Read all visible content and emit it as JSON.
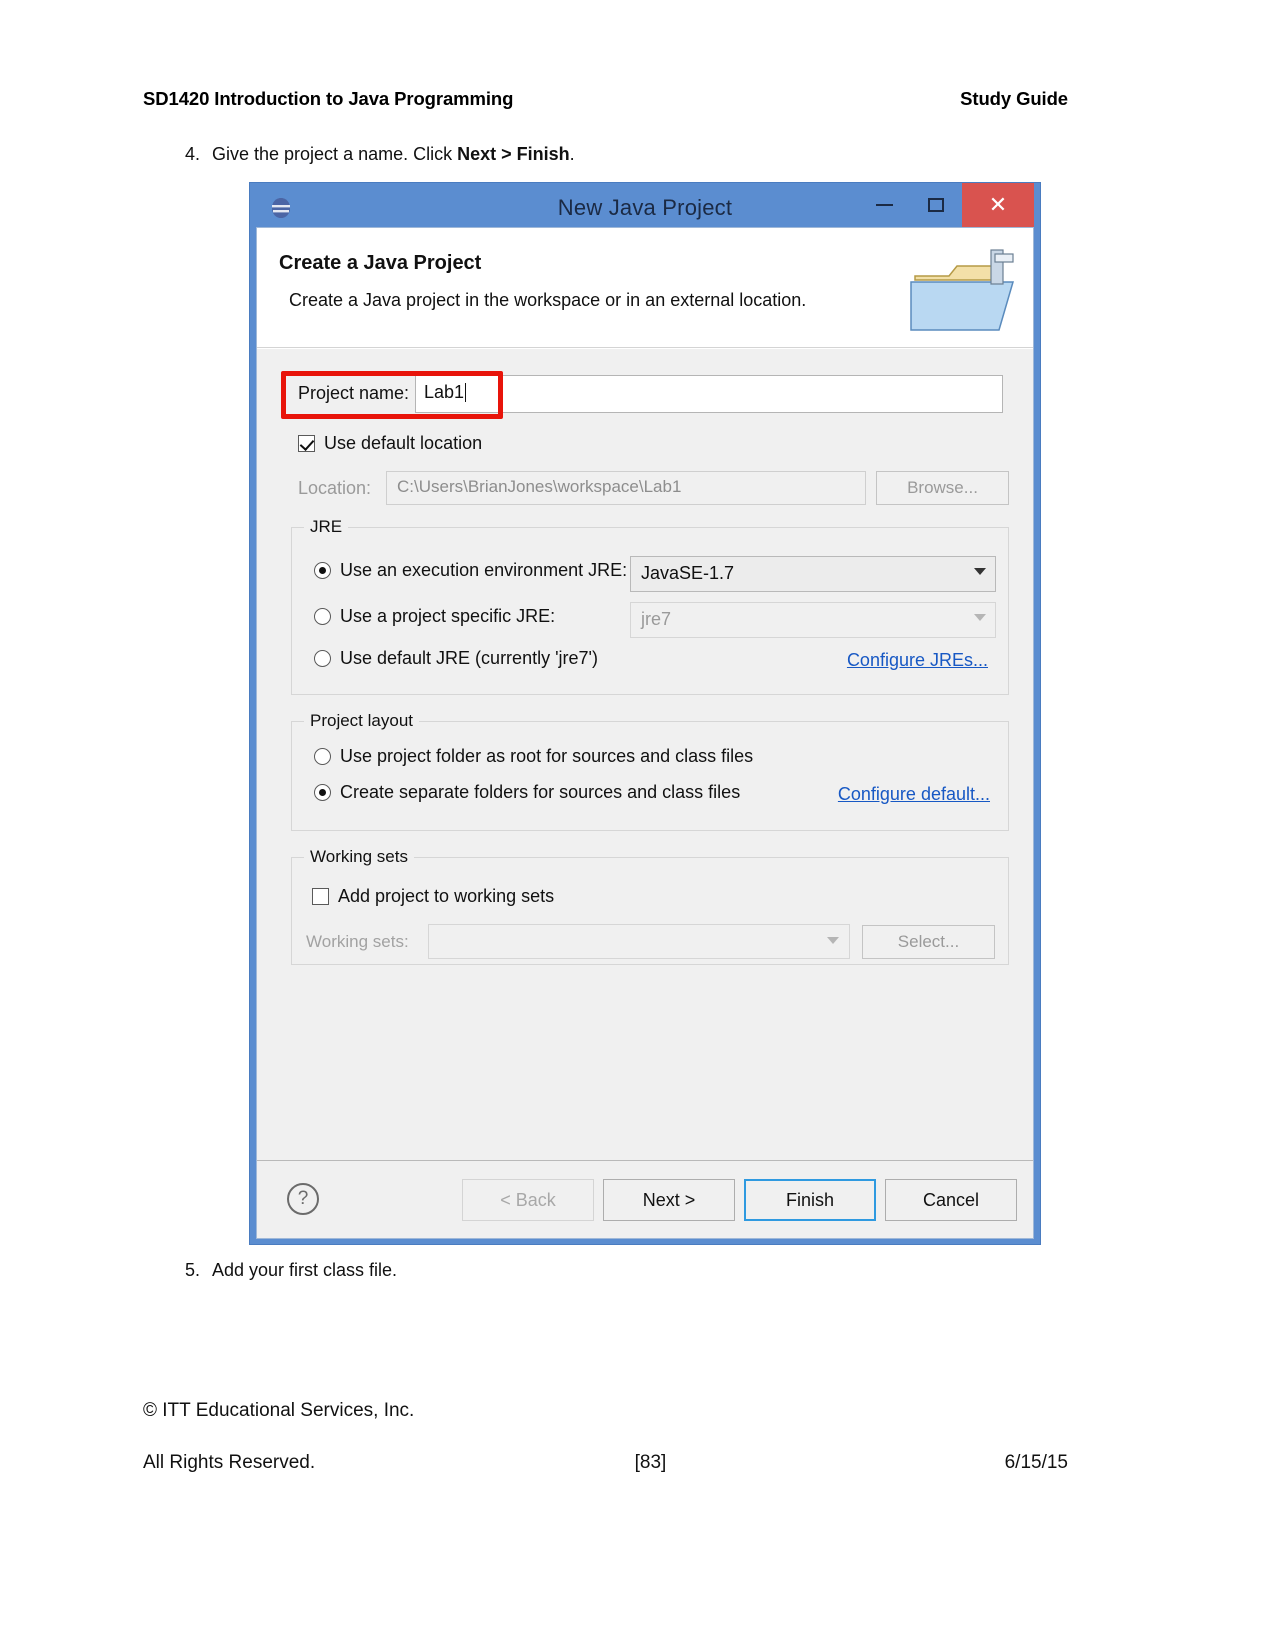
{
  "document": {
    "header_left": "SD1420 Introduction to Java Programming",
    "header_right": "Study Guide",
    "step4": {
      "number": "4.",
      "text_before": "Give the project a name. Click ",
      "bold1": "Next",
      "between": " > ",
      "bold2": "Finish",
      "text_after": "."
    },
    "step5": {
      "number": "5.",
      "text": "Add your first class file."
    },
    "footer": {
      "copyright": "© ITT Educational Services, Inc.",
      "rights": "All Rights Reserved.",
      "page": "[83]",
      "date": "6/15/15"
    }
  },
  "dialog": {
    "title": "New Java Project",
    "window_buttons": {
      "minimize": "–",
      "maximize": "☐",
      "close": "✕"
    },
    "header": {
      "heading": "Create a Java Project",
      "subheading": "Create a Java project in the workspace or in an external location."
    },
    "project_name": {
      "label": "Project name:",
      "value": "Lab1"
    },
    "use_default_location": {
      "label": "Use default location",
      "checked": true
    },
    "location": {
      "label": "Location:",
      "value": "C:\\Users\\BrianJones\\workspace\\Lab1",
      "browse_label": "Browse..."
    },
    "jre": {
      "legend": "JRE",
      "options": [
        {
          "label": "Use an execution environment JRE:",
          "selected": true
        },
        {
          "label": "Use a project specific JRE:",
          "selected": false
        },
        {
          "label": "Use default JRE (currently 'jre7')",
          "selected": false
        }
      ],
      "env_combo_value": "JavaSE-1.7",
      "specific_combo_value": "jre7",
      "configure_link": "Configure JREs..."
    },
    "project_layout": {
      "legend": "Project layout",
      "options": [
        {
          "label": "Use project folder as root for sources and class files",
          "selected": false
        },
        {
          "label": "Create separate folders for sources and class files",
          "selected": true
        }
      ],
      "configure_link": "Configure default..."
    },
    "working_sets": {
      "legend": "Working sets",
      "checkbox_label": "Add project to working sets",
      "checked": false,
      "combo_label": "Working sets:",
      "combo_value": "",
      "select_label": "Select..."
    },
    "buttons": {
      "help": "?",
      "back": "< Back",
      "next": "Next >",
      "finish": "Finish",
      "cancel": "Cancel"
    }
  },
  "colors": {
    "titlebar": "#5b8dd0",
    "close_button": "#d9534f",
    "highlight_box": "#e8140a",
    "link": "#1758c4",
    "default_button_border": "#2f9ae0"
  }
}
